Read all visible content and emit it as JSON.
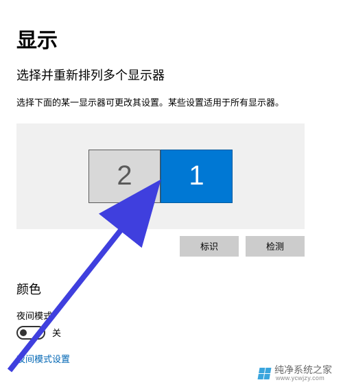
{
  "page": {
    "title": "显示",
    "section_heading": "选择并重新排列多个显示器",
    "description": "选择下面的某一显示器可更改其设置。某些设置适用于所有显示器。"
  },
  "monitors": {
    "inactive_label": "2",
    "active_label": "1"
  },
  "buttons": {
    "identify": "标识",
    "detect": "检测"
  },
  "color": {
    "heading": "颜色",
    "night_light_label": "夜间模式",
    "toggle_state": "关",
    "night_light_settings_link": "夜间模式设置"
  },
  "watermark": {
    "name": "纯净系统之家",
    "url": "www.ycwjzy.com"
  },
  "colors": {
    "accent": "#0078d4",
    "link": "#0066b4",
    "panel_bg": "#f0f0f0",
    "button_bg": "#cccccc",
    "arrow": "#3f3fde"
  }
}
